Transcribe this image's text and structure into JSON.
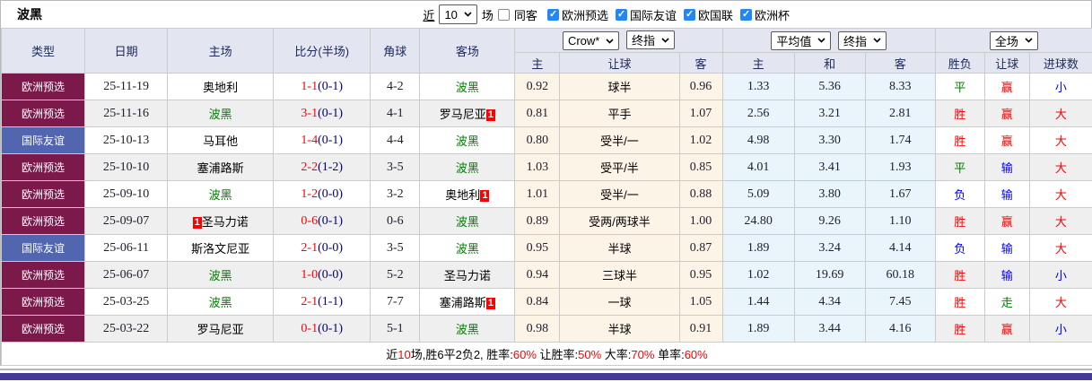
{
  "title": "波黑",
  "toolbar": {
    "recent_label": "近",
    "recent_value": "10",
    "games_label": "场",
    "same_away_label": "同客",
    "same_away_checked": false,
    "filters": [
      {
        "label": "欧洲预选",
        "checked": true
      },
      {
        "label": "国际友谊",
        "checked": true
      },
      {
        "label": "欧国联",
        "checked": true
      },
      {
        "label": "欧洲杯",
        "checked": true
      }
    ]
  },
  "table": {
    "selects": {
      "odds_company": "Crow*",
      "odds_period": "终指",
      "avg": "平均值",
      "avg_period": "终指",
      "scope": "全场"
    },
    "headers_left": [
      "类型",
      "日期",
      "主场",
      "比分(半场)",
      "角球",
      "客场"
    ],
    "sub_headers": [
      "主",
      "让球",
      "客",
      "主",
      "和",
      "客",
      "胜负",
      "让球",
      "进球数"
    ],
    "rows": [
      {
        "type": "欧洲预选",
        "type_style": "maroon",
        "date": "25-11-19",
        "home": "奥地利",
        "home_green": false,
        "home_badge": null,
        "score": "1-1",
        "half": "(0-1)",
        "corner": "4-2",
        "away": "波黑",
        "away_green": true,
        "away_badge": null,
        "crow": [
          "0.92",
          "球半",
          "0.96"
        ],
        "avg": [
          "1.33",
          "5.36",
          "8.33"
        ],
        "results": [
          {
            "text": "平",
            "color": "green"
          },
          {
            "text": "赢",
            "color": "red"
          },
          {
            "text": "小",
            "color": "blue"
          }
        ]
      },
      {
        "type": "欧洲预选",
        "type_style": "maroon",
        "date": "25-11-16",
        "home": "波黑",
        "home_green": true,
        "home_badge": null,
        "score": "3-1",
        "half": "(0-1)",
        "corner": "4-1",
        "away": "罗马尼亚",
        "away_green": false,
        "away_badge": "1",
        "crow": [
          "0.81",
          "平手",
          "1.07"
        ],
        "avg": [
          "2.56",
          "3.21",
          "2.81"
        ],
        "results": [
          {
            "text": "胜",
            "color": "red"
          },
          {
            "text": "赢",
            "color": "red"
          },
          {
            "text": "大",
            "color": "red"
          }
        ]
      },
      {
        "type": "国际友谊",
        "type_style": "blue",
        "date": "25-10-13",
        "home": "马耳他",
        "home_green": false,
        "home_badge": null,
        "score": "1-4",
        "half": "(0-1)",
        "corner": "4-4",
        "away": "波黑",
        "away_green": true,
        "away_badge": null,
        "crow": [
          "0.80",
          "受半/一",
          "1.02"
        ],
        "avg": [
          "4.98",
          "3.30",
          "1.74"
        ],
        "results": [
          {
            "text": "胜",
            "color": "red"
          },
          {
            "text": "赢",
            "color": "red"
          },
          {
            "text": "大",
            "color": "red"
          }
        ]
      },
      {
        "type": "欧洲预选",
        "type_style": "maroon",
        "date": "25-10-10",
        "home": "塞浦路斯",
        "home_green": false,
        "home_badge": null,
        "score": "2-2",
        "half": "(1-2)",
        "corner": "3-5",
        "away": "波黑",
        "away_green": true,
        "away_badge": null,
        "crow": [
          "1.03",
          "受平/半",
          "0.85"
        ],
        "avg": [
          "4.01",
          "3.41",
          "1.93"
        ],
        "results": [
          {
            "text": "平",
            "color": "green"
          },
          {
            "text": "输",
            "color": "blue"
          },
          {
            "text": "大",
            "color": "red"
          }
        ]
      },
      {
        "type": "欧洲预选",
        "type_style": "maroon",
        "date": "25-09-10",
        "home": "波黑",
        "home_green": true,
        "home_badge": null,
        "score": "1-2",
        "half": "(0-0)",
        "corner": "3-2",
        "away": "奥地利",
        "away_green": false,
        "away_badge": "1",
        "crow": [
          "1.01",
          "受半/一",
          "0.88"
        ],
        "avg": [
          "5.09",
          "3.80",
          "1.67"
        ],
        "results": [
          {
            "text": "负",
            "color": "blue"
          },
          {
            "text": "输",
            "color": "blue"
          },
          {
            "text": "大",
            "color": "red"
          }
        ]
      },
      {
        "type": "欧洲预选",
        "type_style": "maroon",
        "date": "25-09-07",
        "home": "圣马力诺",
        "home_green": false,
        "home_badge": "1",
        "score": "0-6",
        "half": "(0-1)",
        "corner": "0-6",
        "away": "波黑",
        "away_green": true,
        "away_badge": null,
        "crow": [
          "0.89",
          "受两/两球半",
          "1.00"
        ],
        "avg": [
          "24.80",
          "9.26",
          "1.10"
        ],
        "results": [
          {
            "text": "胜",
            "color": "red"
          },
          {
            "text": "赢",
            "color": "red"
          },
          {
            "text": "大",
            "color": "red"
          }
        ]
      },
      {
        "type": "国际友谊",
        "type_style": "blue",
        "date": "25-06-11",
        "home": "斯洛文尼亚",
        "home_green": false,
        "home_badge": null,
        "score": "2-1",
        "half": "(0-0)",
        "corner": "3-5",
        "away": "波黑",
        "away_green": true,
        "away_badge": null,
        "crow": [
          "0.95",
          "半球",
          "0.87"
        ],
        "avg": [
          "1.89",
          "3.24",
          "4.14"
        ],
        "results": [
          {
            "text": "负",
            "color": "blue"
          },
          {
            "text": "输",
            "color": "blue"
          },
          {
            "text": "大",
            "color": "red"
          }
        ]
      },
      {
        "type": "欧洲预选",
        "type_style": "maroon",
        "date": "25-06-07",
        "home": "波黑",
        "home_green": true,
        "home_badge": null,
        "score": "1-0",
        "half": "(0-0)",
        "corner": "5-2",
        "away": "圣马力诺",
        "away_green": false,
        "away_badge": null,
        "crow": [
          "0.94",
          "三球半",
          "0.95"
        ],
        "avg": [
          "1.02",
          "19.69",
          "60.18"
        ],
        "results": [
          {
            "text": "胜",
            "color": "red"
          },
          {
            "text": "输",
            "color": "blue"
          },
          {
            "text": "小",
            "color": "blue"
          }
        ]
      },
      {
        "type": "欧洲预选",
        "type_style": "maroon",
        "date": "25-03-25",
        "home": "波黑",
        "home_green": true,
        "home_badge": null,
        "score": "2-1",
        "half": "(1-1)",
        "corner": "7-7",
        "away": "塞浦路斯",
        "away_green": false,
        "away_badge": "1",
        "crow": [
          "0.84",
          "一球",
          "1.05"
        ],
        "avg": [
          "1.44",
          "4.34",
          "7.45"
        ],
        "results": [
          {
            "text": "胜",
            "color": "red"
          },
          {
            "text": "走",
            "color": "green"
          },
          {
            "text": "大",
            "color": "red"
          }
        ]
      },
      {
        "type": "欧洲预选",
        "type_style": "maroon",
        "date": "25-03-22",
        "home": "罗马尼亚",
        "home_green": false,
        "home_badge": null,
        "score": "0-1",
        "half": "(0-1)",
        "corner": "5-1",
        "away": "波黑",
        "away_green": true,
        "away_badge": null,
        "crow": [
          "0.98",
          "半球",
          "0.91"
        ],
        "avg": [
          "1.89",
          "3.44",
          "4.16"
        ],
        "results": [
          {
            "text": "胜",
            "color": "red"
          },
          {
            "text": "赢",
            "color": "red"
          },
          {
            "text": "小",
            "color": "blue"
          }
        ]
      }
    ]
  },
  "summary": {
    "segments": [
      {
        "text": "近",
        "red": false
      },
      {
        "text": "10",
        "red": true
      },
      {
        "text": "场,胜6平2负2, 胜率:",
        "red": false
      },
      {
        "text": "60%",
        "red": true
      },
      {
        "text": " 让胜率:",
        "red": false
      },
      {
        "text": "50%",
        "red": true
      },
      {
        "text": " 大率:",
        "red": false
      },
      {
        "text": "70%",
        "red": true
      },
      {
        "text": " 单率:",
        "red": false
      },
      {
        "text": "60%",
        "red": true
      }
    ]
  },
  "colors": {
    "type_maroon": "#7b1a4a",
    "type_blue": "#5166ae",
    "team_green": "#008000",
    "score_red": "#ff0000",
    "half_navy": "#000080",
    "result_red": "#ff0000",
    "result_green": "#008000",
    "result_blue": "#0000ee",
    "crow_bg": "#fdf4e8",
    "avg_bg": "#eaf4fb",
    "checkbox_blue": "#2386f3",
    "bottom_bar": "#453a96"
  }
}
